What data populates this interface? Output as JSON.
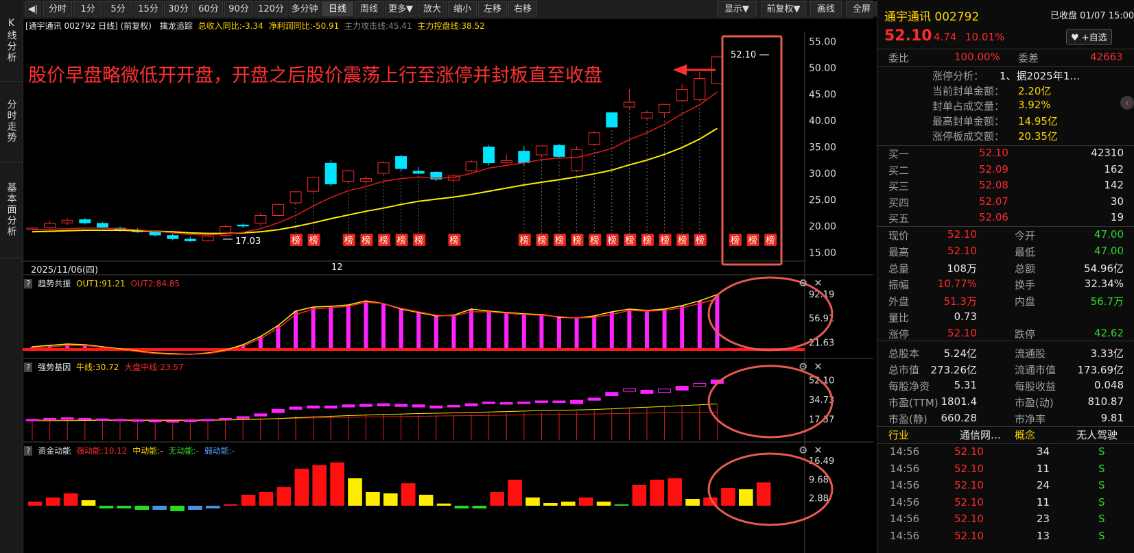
{
  "side_tabs": [
    "K线分析",
    "分时走势",
    "基本面分析"
  ],
  "toolbar": {
    "back": "◀|",
    "buttons": [
      "分时",
      "1分",
      "5分",
      "15分",
      "30分",
      "60分",
      "90分",
      "120分",
      "多分钟",
      "日线",
      "周线",
      "更多▼",
      "放大",
      "缩小",
      "左移",
      "右移"
    ],
    "active": "日线",
    "right_buttons": [
      "显示▼",
      "前复权▼",
      "画线",
      "全屏"
    ]
  },
  "main_info": {
    "title": "[通宇通讯 002792 日线]  (前复权)",
    "indicator": "擒龙追踪",
    "rev": "总收入同比:-3.34",
    "profit": "净利润同比:-50.91",
    "attack": "主力攻击线:45.41",
    "control": "主力控盘线:38.52"
  },
  "annotation": "股价早盘略微低开开盘，开盘之后股价震荡上行至涨停并封板直至收盘",
  "price_axis": [
    "55.00",
    "50.00",
    "45.00",
    "40.00",
    "35.00",
    "30.00",
    "25.00",
    "20.00",
    "15.00"
  ],
  "high_label": "52.10",
  "low_label": "17.03",
  "date_label": "2025/11/06(四)",
  "month_label": "12",
  "bang_label": "榜",
  "panel2": {
    "q": "?",
    "name": "趋势共振",
    "out1": "OUT1:91.21",
    "out2": "OUT2:84.85",
    "axis": [
      "92.19",
      "56.91",
      "21.63"
    ]
  },
  "panel3": {
    "q": "?",
    "name": "强势基因",
    "bull": "牛线:30.72",
    "mid": "大盘中线:23.57",
    "axis": [
      "52.10",
      "34.73",
      "17.37"
    ]
  },
  "panel4": {
    "q": "?",
    "name": "资金动能",
    "strong": "强动能:10.12",
    "middle": "中动能:-",
    "none": "无动能:-",
    "weak": "弱动能:-",
    "axis": [
      "16.49",
      "9.68",
      "2.88"
    ]
  },
  "panel_icons": {
    "gear": "⚙",
    "close": "✕"
  },
  "chart_data": {
    "type": "candlestick",
    "ylim": [
      14,
      56
    ],
    "candles": [
      [
        19.5,
        19.8,
        19.3,
        19.6
      ],
      [
        19.7,
        21.0,
        19.4,
        20.5
      ],
      [
        20.6,
        21.5,
        20.2,
        21.1
      ],
      [
        21.2,
        21.5,
        20.3,
        20.6
      ],
      [
        20.5,
        20.8,
        19.5,
        19.8
      ],
      [
        19.6,
        19.9,
        18.9,
        19.2
      ],
      [
        19.1,
        19.6,
        18.7,
        19.0
      ],
      [
        18.9,
        19.2,
        18.0,
        18.3
      ],
      [
        18.2,
        18.6,
        17.3,
        17.6
      ],
      [
        17.5,
        18.0,
        17.0,
        17.2
      ],
      [
        17.2,
        18.3,
        17.0,
        18.1
      ],
      [
        18.2,
        20.2,
        18.0,
        19.9
      ],
      [
        20.2,
        20.5,
        19.6,
        20.0
      ],
      [
        20.5,
        22.5,
        20.0,
        22.0
      ],
      [
        22.0,
        24.3,
        21.8,
        24.1
      ],
      [
        24.4,
        26.6,
        24.0,
        26.5
      ],
      [
        26.6,
        29.4,
        26.0,
        29.2
      ],
      [
        31.9,
        32.5,
        27.5,
        28.0
      ],
      [
        28.5,
        30.8,
        28.0,
        30.5
      ],
      [
        28.5,
        29.5,
        27.6,
        29.0
      ],
      [
        30.0,
        32.3,
        29.5,
        32.0
      ],
      [
        33.2,
        33.5,
        30.3,
        30.9
      ],
      [
        30.4,
        31.2,
        29.8,
        30.0
      ],
      [
        30.2,
        30.4,
        28.5,
        28.9
      ],
      [
        28.7,
        29.8,
        28.2,
        29.5
      ],
      [
        30.5,
        32.5,
        30.2,
        32.2
      ],
      [
        35.0,
        35.4,
        31.5,
        32.0
      ],
      [
        32.0,
        33.6,
        31.8,
        32.4
      ],
      [
        34.2,
        35.2,
        31.4,
        32.0
      ],
      [
        33.5,
        35.3,
        33.0,
        35.2
      ],
      [
        35.3,
        35.6,
        32.8,
        33.2
      ],
      [
        30.5,
        35.2,
        30.2,
        34.5
      ],
      [
        35.5,
        38.0,
        35.2,
        37.7
      ],
      [
        41.5,
        41.6,
        38.7,
        38.8
      ],
      [
        42.6,
        46.0,
        42.0,
        43.5
      ],
      [
        40.5,
        42.0,
        40.0,
        41.5
      ],
      [
        41.5,
        42.5,
        40.5,
        43.1
      ],
      [
        43.8,
        47.0,
        43.5,
        45.9
      ],
      [
        44.0,
        49.3,
        43.5,
        48.0
      ],
      [
        47.0,
        52.1,
        47.0,
        52.1
      ]
    ],
    "ma_attack": [
      19.3,
      19.4,
      19.5,
      19.6,
      19.6,
      19.5,
      19.3,
      19.0,
      18.7,
      18.4,
      18.3,
      18.5,
      18.8,
      19.5,
      20.6,
      22.0,
      23.8,
      25.4,
      26.7,
      27.5,
      28.5,
      29.0,
      29.3,
      29.1,
      29.2,
      30.0,
      31.0,
      31.5,
      32.0,
      32.6,
      32.9,
      33.0,
      33.8,
      34.7,
      36.4,
      37.7,
      39.3,
      41.3,
      43.0,
      45.41
    ],
    "ma_control": [
      18.9,
      19.0,
      19.1,
      19.2,
      19.2,
      19.2,
      19.1,
      19.0,
      18.9,
      18.7,
      18.6,
      18.6,
      18.7,
      18.9,
      19.3,
      19.9,
      20.6,
      21.4,
      22.1,
      22.8,
      23.4,
      24.1,
      24.7,
      25.1,
      25.5,
      26.0,
      26.6,
      27.2,
      27.8,
      28.3,
      28.8,
      29.3,
      29.9,
      30.6,
      31.6,
      32.5,
      33.6,
      34.9,
      36.5,
      38.52
    ],
    "bang_days": [
      15,
      16,
      18,
      19,
      20,
      21,
      22,
      24,
      28,
      29,
      30,
      31,
      32,
      33,
      34,
      35,
      36,
      37,
      38,
      40,
      41,
      42
    ],
    "trend": {
      "ylim": [
        10,
        95
      ],
      "bars": [
        15,
        17,
        19,
        18,
        15,
        12,
        9,
        6,
        5,
        4,
        6,
        10,
        18,
        30,
        46,
        67,
        73,
        74,
        76,
        82,
        78,
        70,
        65,
        60,
        61,
        70,
        67,
        65,
        63,
        62,
        58,
        57,
        60,
        66,
        70,
        68,
        70,
        75,
        82,
        91.21
      ],
      "out2": [
        13,
        15,
        17,
        17,
        14,
        11,
        8,
        5,
        4,
        4,
        5,
        9,
        16,
        27,
        42,
        62,
        70,
        72,
        74,
        80,
        78,
        71,
        66,
        61,
        60,
        66,
        66,
        64,
        62,
        61,
        59,
        57,
        58,
        62,
        68,
        67,
        68,
        72,
        78,
        84.85
      ]
    },
    "strong": {
      "ylim": [
        0,
        56
      ],
      "boxes": [
        [
          16,
          17
        ],
        [
          17,
          18
        ],
        [
          17.5,
          18.5
        ],
        [
          17,
          18
        ],
        [
          16.5,
          17.5
        ],
        [
          16,
          17
        ],
        [
          15.5,
          16.5
        ],
        [
          15.5,
          16
        ],
        [
          15.2,
          15.8
        ],
        [
          15.5,
          16.2
        ],
        [
          16,
          17
        ],
        [
          17,
          18
        ],
        [
          18,
          19.5
        ],
        [
          20,
          22
        ],
        [
          23,
          26
        ],
        [
          26,
          28
        ],
        [
          27,
          29
        ],
        [
          27,
          29
        ],
        [
          28,
          30
        ],
        [
          28.5,
          30.5
        ],
        [
          29,
          31
        ],
        [
          28.5,
          30.5
        ],
        [
          28,
          30
        ],
        [
          27,
          29
        ],
        [
          28,
          29.5
        ],
        [
          29,
          31
        ],
        [
          31,
          32.5
        ],
        [
          30.5,
          32
        ],
        [
          31,
          32.5
        ],
        [
          32,
          33.5
        ],
        [
          32,
          33.5
        ],
        [
          31,
          34
        ],
        [
          34,
          36
        ],
        [
          38,
          41
        ],
        [
          42,
          44.5
        ],
        [
          40,
          43
        ],
        [
          41,
          44
        ],
        [
          43,
          46.5
        ],
        [
          46,
          49
        ],
        [
          49,
          52.1
        ]
      ],
      "bull": [
        15.8,
        15.9,
        16.0,
        16.1,
        16.2,
        16.2,
        16.2,
        16.2,
        16.2,
        16.2,
        16.3,
        16.5,
        16.8,
        17.2,
        17.8,
        18.5,
        19.2,
        19.8,
        20.4,
        20.9,
        21.4,
        21.8,
        22.2,
        22.5,
        22.8,
        23.2,
        23.6,
        24.0,
        24.4,
        24.8,
        25.1,
        25.4,
        25.8,
        26.4,
        27.2,
        27.8,
        28.5,
        29.3,
        30.0,
        30.72
      ],
      "mid": [
        16.5,
        16.6,
        16.6,
        16.7,
        16.8,
        16.8,
        16.8,
        16.8,
        16.8,
        16.8,
        16.9,
        17.0,
        17.2,
        17.4,
        17.7,
        18.0,
        18.3,
        18.6,
        18.9,
        19.2,
        19.4,
        19.6,
        19.8,
        20.0,
        20.2,
        20.4,
        20.6,
        20.8,
        21.0,
        21.2,
        21.4,
        21.6,
        21.8,
        22.1,
        22.4,
        22.7,
        23.0,
        23.2,
        23.4,
        23.57
      ],
      "stems": [
        16,
        16.5,
        17,
        16.5,
        16,
        15.5,
        15.5,
        15.2,
        15,
        15,
        15.5,
        16,
        17,
        18,
        19,
        20,
        20.5,
        21,
        21.5,
        22,
        22,
        21.5,
        21,
        21,
        21.5,
        22,
        22.5,
        22.5,
        23,
        23,
        23.5,
        24,
        25,
        26,
        27,
        27.5,
        28,
        29,
        30,
        31
      ]
    },
    "money": {
      "ylim": [
        -2,
        17
      ],
      "values": [
        1.5,
        3.0,
        4.5,
        2.0,
        -1.0,
        -1.0,
        -1.5,
        -1.5,
        -2.0,
        -1.5,
        -1.0,
        0.5,
        4.0,
        5.0,
        6.8,
        13.5,
        14.8,
        15.8,
        10.0,
        5.0,
        4.5,
        8.2,
        4.0,
        0.8,
        -1.0,
        -1.0,
        5.0,
        9.5,
        3.0,
        1.0,
        1.5,
        3.0,
        1.5,
        0.5,
        7.5,
        9.5,
        10.0,
        2.5,
        3.0,
        6.5,
        6.0,
        8.5
      ],
      "colors": [
        "red",
        "red",
        "red",
        "yellow",
        "green",
        "green",
        "green",
        "blue",
        "green",
        "blue",
        "blue",
        "red",
        "red",
        "red",
        "red",
        "red",
        "red",
        "red",
        "yellow",
        "yellow",
        "yellow",
        "red",
        "yellow",
        "yellow",
        "green",
        "green",
        "red",
        "red",
        "yellow",
        "yellow",
        "yellow",
        "red",
        "yellow",
        "green",
        "red",
        "red",
        "red",
        "yellow",
        "red",
        "red",
        "yellow",
        "red"
      ]
    }
  },
  "quote": {
    "name": "通宇通讯",
    "code": "002792",
    "status": "已收盘 01/07 15:00",
    "price": "52.10",
    "change": "4.74",
    "pct": "10.01%",
    "fav": "♥ +自选",
    "weibi_l": "委比",
    "weibi_v": "100.00%",
    "weicha_l": "委差",
    "weicha_v": "42663",
    "zt_lines": [
      {
        "l": "涨停分析：",
        "v": "1、据2025年1…"
      },
      {
        "l": "当前封单金额：",
        "v": "2.20亿"
      },
      {
        "l": "封单占成交量：",
        "v": "3.92%"
      },
      {
        "l": "最高封单金额：",
        "v": "14.95亿"
      },
      {
        "l": "涨停板成交额：",
        "v": "20.35亿"
      }
    ],
    "bids": [
      {
        "l": "买一",
        "p": "52.10",
        "v": "42310"
      },
      {
        "l": "买二",
        "p": "52.09",
        "v": "162"
      },
      {
        "l": "买三",
        "p": "52.08",
        "v": "142"
      },
      {
        "l": "买四",
        "p": "52.07",
        "v": "30"
      },
      {
        "l": "买五",
        "p": "52.06",
        "v": "19"
      }
    ],
    "stats": [
      {
        "l1": "现价",
        "v1": "52.10",
        "c1": "red",
        "l2": "今开",
        "v2": "47.00",
        "c2": "green"
      },
      {
        "l1": "最高",
        "v1": "52.10",
        "c1": "red",
        "l2": "最低",
        "v2": "47.00",
        "c2": "green"
      },
      {
        "l1": "总量",
        "v1": "108万",
        "c1": "white",
        "l2": "总额",
        "v2": "54.96亿",
        "c2": "white"
      },
      {
        "l1": "振幅",
        "v1": "10.77%",
        "c1": "red",
        "l2": "换手",
        "v2": "32.34%",
        "c2": "white"
      },
      {
        "l1": "外盘",
        "v1": "51.3万",
        "c1": "red",
        "l2": "内盘",
        "v2": "56.7万",
        "c2": "green"
      },
      {
        "l1": "量比",
        "v1": "0.73",
        "c1": "white",
        "l2": "",
        "v2": "",
        "c2": "white"
      },
      {
        "l1": "涨停",
        "v1": "52.10",
        "c1": "red",
        "l2": "跌停",
        "v2": "42.62",
        "c2": "green"
      },
      {
        "l1": "总股本",
        "v1": "5.24亿",
        "c1": "white",
        "l2": "流通股",
        "v2": "3.33亿",
        "c2": "white"
      },
      {
        "l1": "总市值",
        "v1": "273.26亿",
        "c1": "white",
        "l2": "流通市值",
        "v2": "173.69亿",
        "c2": "white"
      },
      {
        "l1": "每股净资",
        "v1": "5.31",
        "c1": "white",
        "l2": "每股收益",
        "v2": "0.048",
        "c2": "white"
      },
      {
        "l1": "市盈(TTM)",
        "v1": "1801.4",
        "c1": "white",
        "l2": "市盈(动)",
        "v2": "810.87",
        "c2": "white"
      },
      {
        "l1": "市盈(静)",
        "v1": "660.28",
        "c1": "white",
        "l2": "市净率",
        "v2": "9.81",
        "c2": "white"
      }
    ],
    "industry_l": "行业",
    "industry_v": "通信网…",
    "concept_l": "概念",
    "concept_v": "无人驾驶",
    "ticks": [
      {
        "t": "14:56",
        "p": "52.10",
        "v": "34",
        "s": "S"
      },
      {
        "t": "14:56",
        "p": "52.10",
        "v": "11",
        "s": "S"
      },
      {
        "t": "14:56",
        "p": "52.10",
        "v": "24",
        "s": "S"
      },
      {
        "t": "14:56",
        "p": "52.10",
        "v": "11",
        "s": "S"
      },
      {
        "t": "14:56",
        "p": "52.10",
        "v": "23",
        "s": "S"
      },
      {
        "t": "14:56",
        "p": "52.10",
        "v": "13",
        "s": "S"
      }
    ],
    "side_arrow": "‹"
  },
  "colors": {
    "up": "#ff2a2a",
    "down": "#00e5ff",
    "attack": "#e81a1a",
    "control": "#ffee00",
    "magenta": "#ff22ff",
    "circle": "#e85a50"
  }
}
